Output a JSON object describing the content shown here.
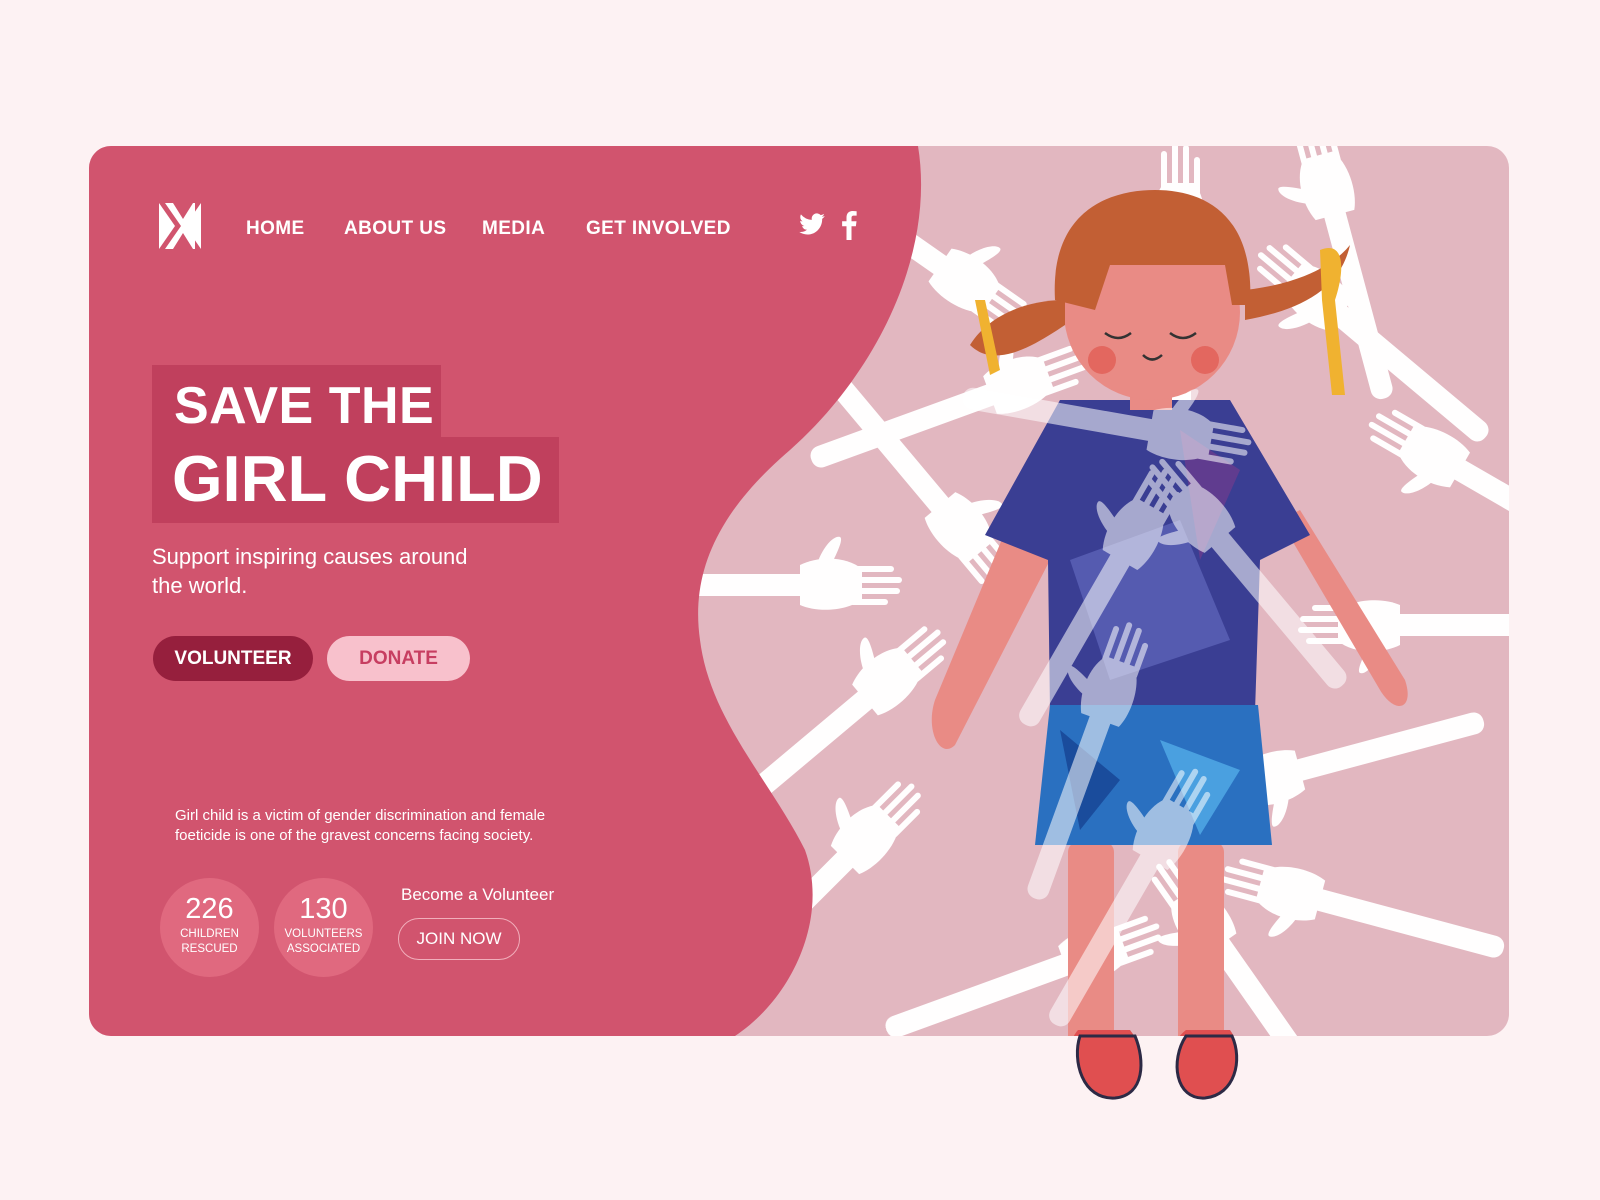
{
  "nav": {
    "home": "HOME",
    "about": "ABOUT US",
    "media": "MEDIA",
    "get_involved": "GET INVOLVED"
  },
  "social": {
    "twitter": "twitter-icon",
    "facebook": "facebook-icon"
  },
  "hero": {
    "line1": "SAVE THE",
    "line2": "GIRL CHILD",
    "subtitle": "Support inspiring causes around the world."
  },
  "buttons": {
    "volunteer": "VOLUNTEER",
    "donate": "DONATE"
  },
  "description": "Girl child is a victim of gender discrimination and female foeticide is one of the gravest concerns facing society.",
  "stats": [
    {
      "value": "226",
      "label": "CHILDREN RESCUED"
    },
    {
      "value": "130",
      "label": "VOLUNTEERS ASSOCIATED"
    }
  ],
  "cta": {
    "text": "Become a Volunteer",
    "button": "JOIN NOW"
  },
  "colors": {
    "background": "#fdf2f3",
    "panel": "#d1546e",
    "title_box": "#c0405d",
    "volunteer_button": "#961f3d",
    "donate_button": "#f8c1cc",
    "illustration_bg": "#e2b7c0"
  }
}
